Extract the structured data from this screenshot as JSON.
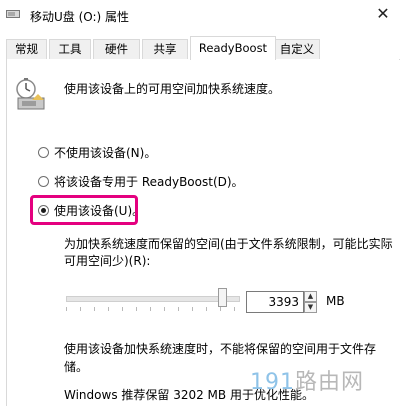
{
  "window": {
    "title": "移动U盘 (O:) 属性",
    "close_glyph": "✕"
  },
  "tabs": [
    {
      "label": "常规",
      "active": false
    },
    {
      "label": "工具",
      "active": false
    },
    {
      "label": "硬件",
      "active": false
    },
    {
      "label": "共享",
      "active": false
    },
    {
      "label": "ReadyBoost",
      "active": true
    },
    {
      "label": "自定义",
      "active": false
    }
  ],
  "readyboost": {
    "intro": "使用该设备上的可用空间加快系统速度。",
    "options": [
      {
        "label": "不使用该设备(N)。",
        "checked": false
      },
      {
        "label": "将该设备专用于 ReadyBoost(D)。",
        "checked": false
      },
      {
        "label": "使用该设备(U)。",
        "checked": true
      }
    ],
    "highlight_color": "#e4007f",
    "reserve_label": "为加快系统速度而保留的空间(由于文件系统限制，可能比实际可用空间少)(R):",
    "reserve_value": "3393",
    "reserve_unit": "MB",
    "note": "使用该设备加快系统速度时，不能将保留的空间用于文件存储。",
    "recommend": "Windows 推荐保留 3202 MB 用于优化性能。"
  },
  "watermark": {
    "number": "191",
    "text": "路由网"
  },
  "icons": {
    "title": "usb-drive-icon",
    "drive": "readyboost-drive-icon"
  }
}
